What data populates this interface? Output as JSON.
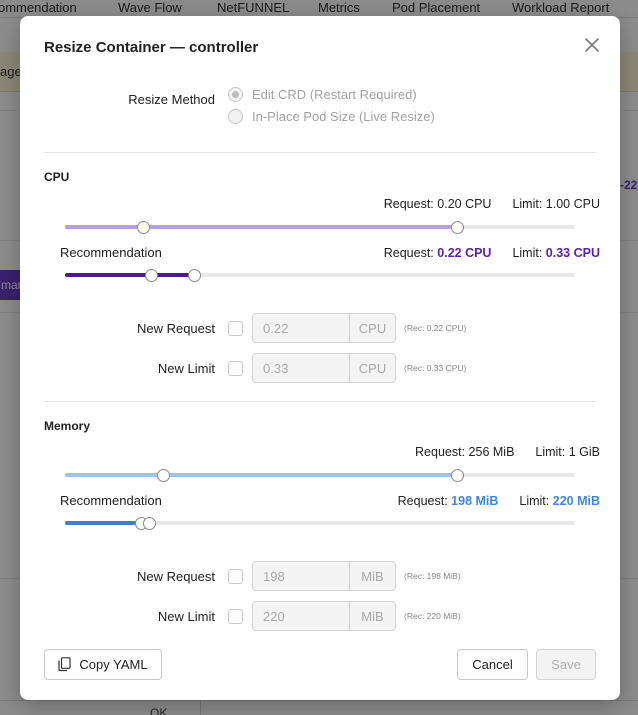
{
  "background": {
    "tabs": [
      "ommendation",
      "Wave Flow",
      "NetFUNNEL",
      "Metrics",
      "Pod Placement",
      "Workload Report"
    ],
    "banner_text": "age",
    "pill_text": "mar",
    "right_value": "-22",
    "bottom_text": "OK"
  },
  "modal": {
    "title": "Resize Container — controller",
    "resize_method": {
      "label": "Resize Method",
      "options": [
        "Edit CRD (Restart Required)",
        "In-Place Pod Size (Live Resize)"
      ],
      "selected_index": 0
    },
    "cpu": {
      "title": "CPU",
      "current": {
        "request_label": "Request:",
        "request_value": "0.20 CPU",
        "limit_label": "Limit:",
        "limit_value": "1.00 CPU",
        "request": 0.2,
        "limit": 1.0
      },
      "recommendation": {
        "title": "Recommendation",
        "request_label": "Request:",
        "request_value": "0.22 CPU",
        "limit_label": "Limit:",
        "limit_value": "0.33 CPU",
        "request": 0.22,
        "limit": 0.33
      },
      "slider_max": 1.3,
      "current_color": "#b79ee6",
      "rec_color": "#4a1a9a",
      "value_color": "#5b1fb0",
      "new_request": {
        "label": "New Request",
        "value": "0.22",
        "unit": "CPU",
        "hint": "(Rec: 0.22 CPU)"
      },
      "new_limit": {
        "label": "New Limit",
        "value": "0.33",
        "unit": "CPU",
        "hint": "(Rec: 0.33 CPU)"
      }
    },
    "memory": {
      "title": "Memory",
      "current": {
        "request_label": "Request:",
        "request_value": "256 MiB",
        "limit_label": "Limit:",
        "limit_value": "1 GiB",
        "request": 256,
        "limit": 1024
      },
      "recommendation": {
        "title": "Recommendation",
        "request_label": "Request:",
        "request_value": "198 MiB",
        "limit_label": "Limit:",
        "limit_value": "220 MiB",
        "request": 198,
        "limit": 220
      },
      "slider_max": 1331,
      "current_color": "#9cc3ee",
      "rec_color": "#3f7fd6",
      "value_color": "#3f86e0",
      "new_request": {
        "label": "New Request",
        "value": "198",
        "unit": "MiB",
        "hint": "(Rec: 198 MiB)"
      },
      "new_limit": {
        "label": "New Limit",
        "value": "220",
        "unit": "MiB",
        "hint": "(Rec: 220 MiB)"
      }
    },
    "buttons": {
      "copy_yaml": "Copy YAML",
      "cancel": "Cancel",
      "save": "Save"
    }
  }
}
